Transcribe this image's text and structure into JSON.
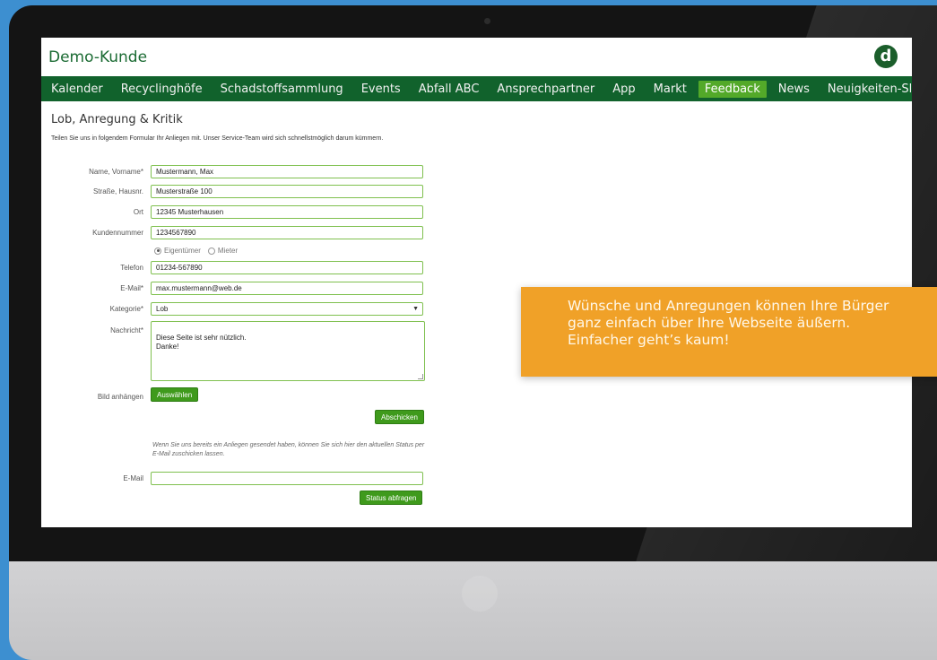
{
  "header": {
    "site_title": "Demo-Kunde",
    "logo_letter": "d"
  },
  "nav": {
    "items": [
      {
        "label": "Kalender"
      },
      {
        "label": "Recyclinghöfe"
      },
      {
        "label": "Schadstoffsammlung"
      },
      {
        "label": "Events"
      },
      {
        "label": "Abfall ABC"
      },
      {
        "label": "Ansprechpartner"
      },
      {
        "label": "App"
      },
      {
        "label": "Markt"
      },
      {
        "label": "Feedback"
      },
      {
        "label": "News"
      },
      {
        "label": "Neuigkeiten-Slider"
      }
    ],
    "active": "Feedback"
  },
  "page": {
    "title": "Lob, Anregung & Kritik",
    "intro": "Teilen Sie uns in folgendem Formular Ihr Anliegen mit. Unser Service-Team wird sich schnellstmöglich darum kümmern."
  },
  "form": {
    "name": {
      "label": "Name, Vorname*",
      "value": "Mustermann, Max"
    },
    "street": {
      "label": "Straße, Hausnr.",
      "value": "Musterstraße 100"
    },
    "city": {
      "label": "Ort",
      "value": "12345 Musterhausen"
    },
    "customer_number": {
      "label": "Kundennummer",
      "value": "1234567890"
    },
    "owner_type": {
      "options": [
        "Eigentümer",
        "Mieter"
      ],
      "selected": "Eigentümer"
    },
    "phone": {
      "label": "Telefon",
      "value": "01234-567890"
    },
    "email": {
      "label": "E-Mail*",
      "value": "max.mustermann@web.de"
    },
    "category": {
      "label": "Kategorie*",
      "value": "Lob"
    },
    "message": {
      "label": "Nachricht*",
      "value": "Diese Seite ist sehr nützlich.\nDanke!"
    },
    "attach": {
      "label": "Bild anhängen",
      "button_label": "Auswählen"
    },
    "submit_label": "Abschicken"
  },
  "status": {
    "hint": "Wenn Sie uns bereits ein Anliegen gesendet haben, können Sie sich hier den aktuellen Status per E-Mail zuschicken lassen.",
    "email_label": "E-Mail",
    "email_value": "",
    "button_label": "Status abfragen"
  },
  "callout": {
    "line1": "Wünsche und Anregungen können Ihre Bürger",
    "line2": "ganz einfach über Ihre Webseite äußern.",
    "line3": "Einfacher geht’s kaum!"
  },
  "colors": {
    "nav_bg": "#11622c",
    "nav_active": "#53a929",
    "button": "#3f9a1c",
    "field_border": "#7fc04f",
    "callout": "#f0a128",
    "background": "#3d8fd0"
  }
}
